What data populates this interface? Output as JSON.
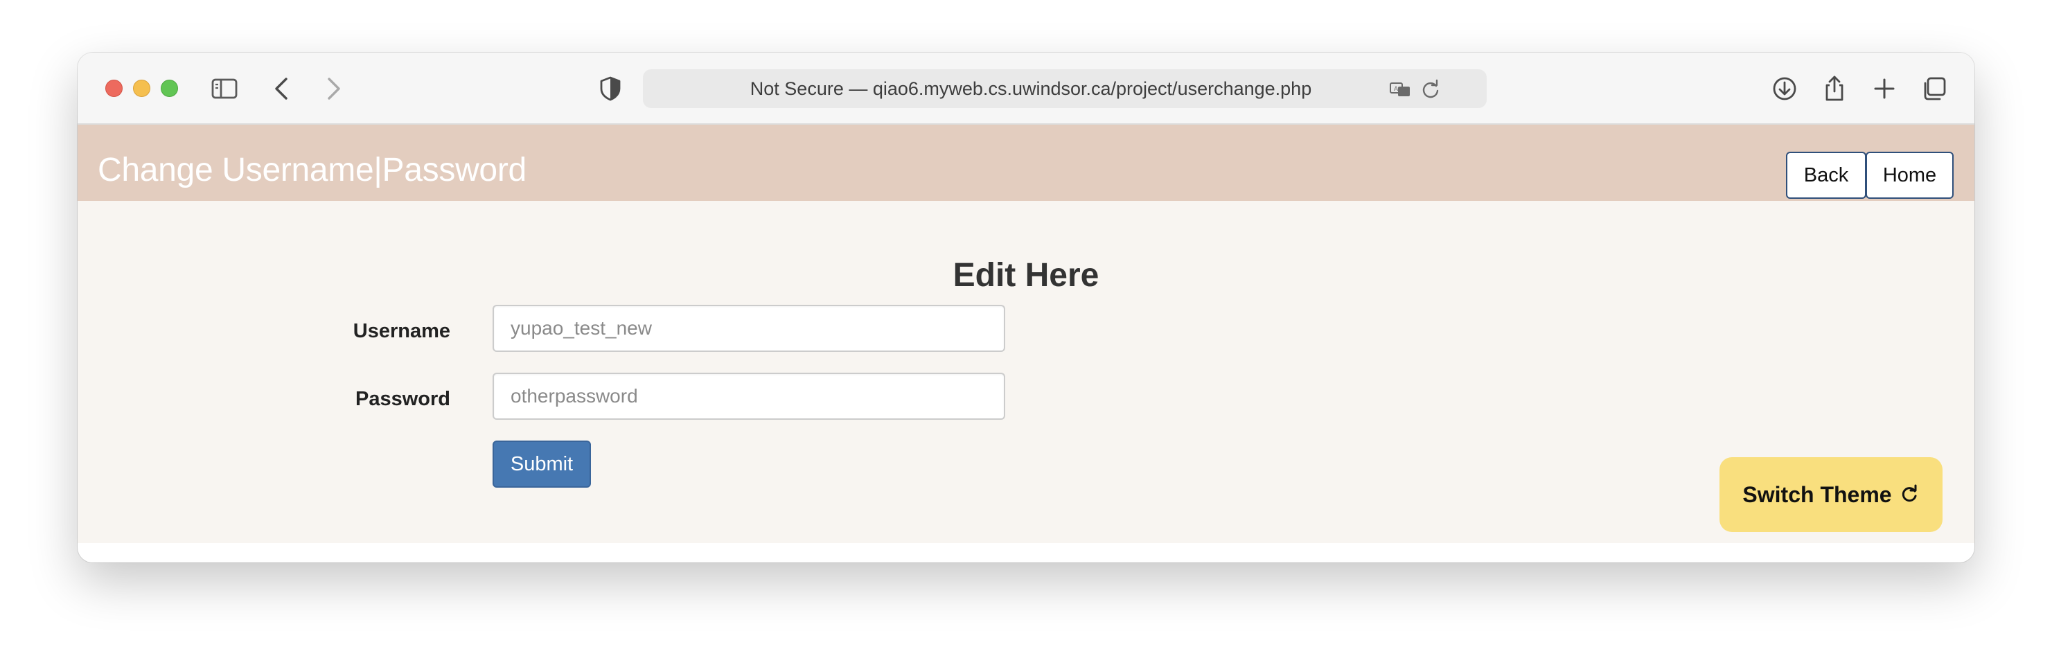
{
  "browser": {
    "address_text": "Not Secure — qiao6.myweb.cs.uwindsor.ca/project/userchange.php",
    "icons": [
      "sidebar-icon",
      "back-arrow-icon",
      "forward-arrow-icon",
      "shield-icon",
      "translate-icon",
      "reload-icon",
      "download-icon",
      "share-icon",
      "new-tab-icon",
      "tab-overview-icon"
    ]
  },
  "header": {
    "title": "Change Username|Password",
    "back_label": "Back",
    "home_label": "Home"
  },
  "form": {
    "heading": "Edit Here",
    "username_label": "Username",
    "username_placeholder": "yupao_test_new",
    "password_label": "Password",
    "password_placeholder": "otherpassword",
    "submit_label": "Submit"
  },
  "theme_button": {
    "label": "Switch Theme",
    "icon": "refresh-icon"
  },
  "colors": {
    "header_bg": "#e3cdbf",
    "page_bg": "#f8f5f1",
    "submit_bg": "#4678b2",
    "theme_button_bg": "#f9df7e"
  }
}
